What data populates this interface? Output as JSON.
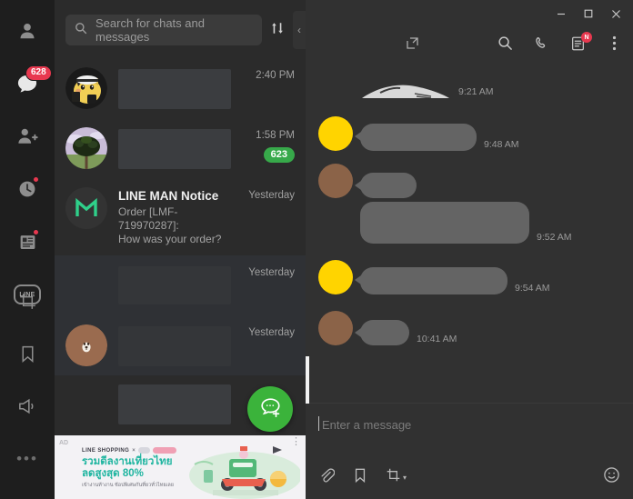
{
  "sidebar": {
    "top_items": [
      {
        "name": "profile",
        "icon": "person-icon",
        "badge": null,
        "dot": false
      },
      {
        "name": "chats",
        "icon": "chat-bubble-icon",
        "badge": "628",
        "dot": false
      },
      {
        "name": "add-friends",
        "icon": "person-add-icon",
        "badge": null,
        "dot": false
      },
      {
        "name": "timeline",
        "icon": "clock-icon",
        "badge": null,
        "dot": true
      },
      {
        "name": "news",
        "icon": "news-feed-icon",
        "badge": null,
        "dot": true
      },
      {
        "name": "line-services",
        "icon": "line-logo-icon",
        "label": "LINE",
        "badge": null,
        "dot": false
      }
    ],
    "bottom_items": [
      {
        "name": "screenshot",
        "icon": "crop-icon"
      },
      {
        "name": "keep",
        "icon": "bookmark-icon"
      },
      {
        "name": "announcements",
        "icon": "megaphone-icon"
      },
      {
        "name": "more",
        "icon": "ellipsis-icon",
        "label": "•••"
      }
    ]
  },
  "search": {
    "placeholder": "Search for chats and messages",
    "icon": "search-icon",
    "sort_icon": "sort-arrows-icon",
    "collapse_label": "‹"
  },
  "chat_list": {
    "rows": [
      {
        "avatar_type": "pikachu-photo",
        "title": null,
        "preview": null,
        "redacted": true,
        "timestamp": "2:40 PM",
        "badge": null
      },
      {
        "avatar_type": "tree-photo",
        "title": null,
        "preview": null,
        "redacted": true,
        "timestamp": "1:58 PM",
        "badge": "623"
      },
      {
        "avatar_type": "lineman-logo",
        "title": "LINE MAN Notice",
        "preview_line1": "Order [LMF-719970287]:",
        "preview_line2": "How was your order?",
        "redacted": false,
        "timestamp": "Yesterday",
        "badge": null
      },
      {
        "avatar_type": "none",
        "title": null,
        "preview": null,
        "redacted": true,
        "timestamp": "Yesterday",
        "badge": null
      },
      {
        "avatar_type": "brown-bear",
        "title": null,
        "preview": null,
        "redacted": true,
        "timestamp": "Yesterday",
        "badge": null
      },
      {
        "avatar_type": "none",
        "title": null,
        "preview": null,
        "redacted": true,
        "timestamp": null,
        "badge": null
      }
    ],
    "new_chat_icon": "new-chat-icon"
  },
  "banner_ad": {
    "ad_label": "AD",
    "brand": "LINE SHOPPING",
    "brand_separator": "×",
    "headline_line1": "รวมดีลงานเที่ยวไทย",
    "headline_line2": "ลดสูงสุด 80%",
    "subline": "เข้างานท้างาน ช้อปพิเศษกันที่ยวทั่วไทยเลย",
    "more_icon": "banner-more-icon"
  },
  "window_controls": {
    "minimize": "–",
    "maximize": "□",
    "close": "✕"
  },
  "conversation_toolbar": {
    "items": [
      {
        "name": "open-in-new-window",
        "icon": "external-window-icon",
        "badge": null
      },
      {
        "name": "search-in-chat",
        "icon": "search-icon",
        "badge": null
      },
      {
        "name": "voice-call",
        "icon": "phone-icon",
        "badge": null
      },
      {
        "name": "notes",
        "icon": "notes-icon",
        "badge": "N"
      },
      {
        "name": "chat-menu",
        "icon": "vertical-dots-icon",
        "badge": null
      }
    ]
  },
  "messages": [
    {
      "sender": "other",
      "avatar_color": null,
      "type": "sticker",
      "redacted": true,
      "timestamp": "9:21 AM",
      "bubble_w": 0,
      "bubble_h": 0
    },
    {
      "sender": "other",
      "avatar_color": "#FFD400",
      "type": "text",
      "redacted": true,
      "timestamp": "9:48 AM",
      "bubble_w": 128,
      "bubble_h": 30
    },
    {
      "sender": "other",
      "avatar_color": "#8B6348",
      "type": "text",
      "redacted": true,
      "timestamp": null,
      "bubble_w": 62,
      "bubble_h": 28
    },
    {
      "sender": "other",
      "avatar_color": null,
      "type": "text",
      "redacted": true,
      "timestamp": "9:52 AM",
      "bubble_w": 186,
      "bubble_h": 46
    },
    {
      "sender": "other",
      "avatar_color": "#FFD400",
      "type": "text",
      "redacted": true,
      "timestamp": "9:54 AM",
      "bubble_w": 162,
      "bubble_h": 30
    },
    {
      "sender": "other",
      "avatar_color": "#8B6348",
      "type": "text",
      "redacted": true,
      "timestamp": "10:41 AM",
      "bubble_w": 54,
      "bubble_h": 28
    }
  ],
  "composer": {
    "placeholder": "Enter a message",
    "tools": [
      {
        "name": "attach-file",
        "icon": "paperclip-icon"
      },
      {
        "name": "keep-bookmark",
        "icon": "bookmark-icon"
      },
      {
        "name": "screen-capture",
        "icon": "crop-icon",
        "caret": "▾"
      }
    ],
    "emoji": {
      "name": "emoji-picker",
      "icon": "smiley-icon"
    }
  },
  "colors": {
    "rail_bg": "#1e1e1e",
    "list_bg": "#2b2b2b",
    "conv_bg": "#313131",
    "accent_green": "#3bb33b",
    "badge_red": "#e8384f",
    "bubble_gray": "#646464"
  }
}
